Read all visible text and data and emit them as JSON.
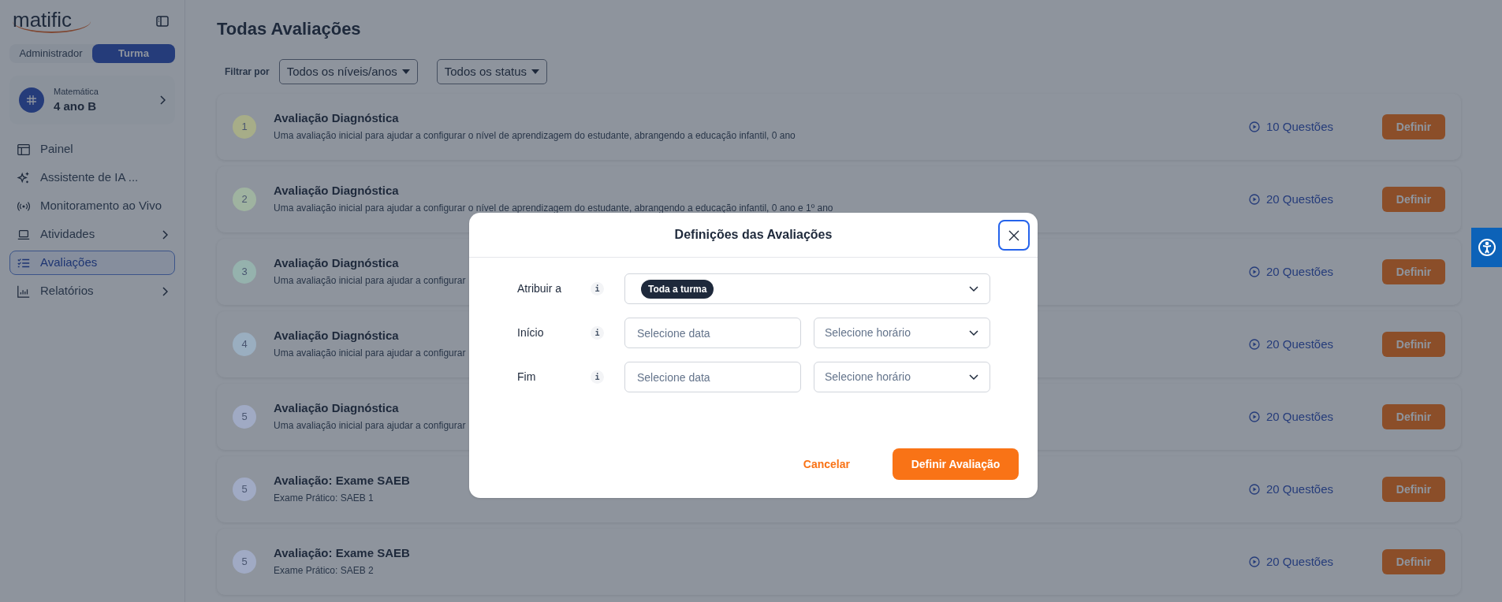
{
  "sidebar": {
    "logo": "matific",
    "role_tabs": [
      {
        "label": "Administrador",
        "selected": false
      },
      {
        "label": "Turma",
        "selected": true
      }
    ],
    "class_card": {
      "subject": "Matemática",
      "name": "4 ano B"
    },
    "nav": [
      {
        "label": "Painel",
        "selected": false,
        "chevron": false
      },
      {
        "label": "Assistente de IA ...",
        "selected": false,
        "chevron": false
      },
      {
        "label": "Monitoramento ao Vivo",
        "selected": false,
        "chevron": false
      },
      {
        "label": "Atividades",
        "selected": false,
        "chevron": true
      },
      {
        "label": "Avaliações",
        "selected": true,
        "chevron": false
      },
      {
        "label": "Relatórios",
        "selected": false,
        "chevron": true
      }
    ]
  },
  "page_title": "Todas Avaliações",
  "filters": {
    "label": "Filtrar por",
    "dropdowns": [
      "Todos os níveis/anos",
      "Todos os status"
    ]
  },
  "assessments": [
    {
      "number": "1",
      "color": "#a7ad88",
      "title": "Avaliação Diagnóstica",
      "description": "Uma avaliação inicial para ajudar a configurar o nível de aprendizagem do estudante, abrangendo a educação infantil, 0 ano",
      "questions": "10 Questões",
      "button": "Definir"
    },
    {
      "number": "2",
      "color": "#9fb3a0",
      "title": "Avaliação Diagnóstica",
      "description": "Uma avaliação inicial para ajudar a configurar o nível de aprendizagem do estudante, abrangendo a educação infantil, 0 ano e 1º ano",
      "questions": "20 Questões",
      "button": "Definir"
    },
    {
      "number": "3",
      "color": "#95b2ad",
      "title": "Avaliação Diagnóstica",
      "description": "Uma avaliação inicial para ajudar a configurar",
      "questions": "20 Questões",
      "button": "Definir"
    },
    {
      "number": "4",
      "color": "#9aaec0",
      "title": "Avaliação Diagnóstica",
      "description": "Uma avaliação inicial para ajudar a configurar",
      "questions": "20 Questões",
      "button": "Definir"
    },
    {
      "number": "5",
      "color": "#a0aac4",
      "title": "Avaliação Diagnóstica",
      "description": "Uma avaliação inicial para ajudar a configurar",
      "questions": "20 Questões",
      "button": "Definir"
    },
    {
      "number": "5",
      "color": "#a0aac4",
      "title": "Avaliação: Exame SAEB",
      "description": "Exame Prático: SAEB 1",
      "questions": "20 Questões",
      "button": "Definir"
    },
    {
      "number": "5",
      "color": "#a0aac4",
      "title": "Avaliação: Exame SAEB",
      "description": "Exame Prático: SAEB 2",
      "questions": "20 Questões",
      "button": "Definir"
    }
  ],
  "modal": {
    "title": "Definições das Avaliações",
    "rows": [
      {
        "label": "Atribuir a",
        "info": "i",
        "kind": "select",
        "tag": "Toda a turma"
      },
      {
        "label": "Início",
        "info": "i",
        "kind": "datetime",
        "date_placeholder": "Selecione data",
        "time_placeholder": "Selecione horário"
      },
      {
        "label": "Fim",
        "info": "i",
        "kind": "datetime",
        "date_placeholder": "Selecione data",
        "time_placeholder": "Selecione horário"
      }
    ],
    "cancel": "Cancelar",
    "confirm": "Definir Avaliação"
  }
}
